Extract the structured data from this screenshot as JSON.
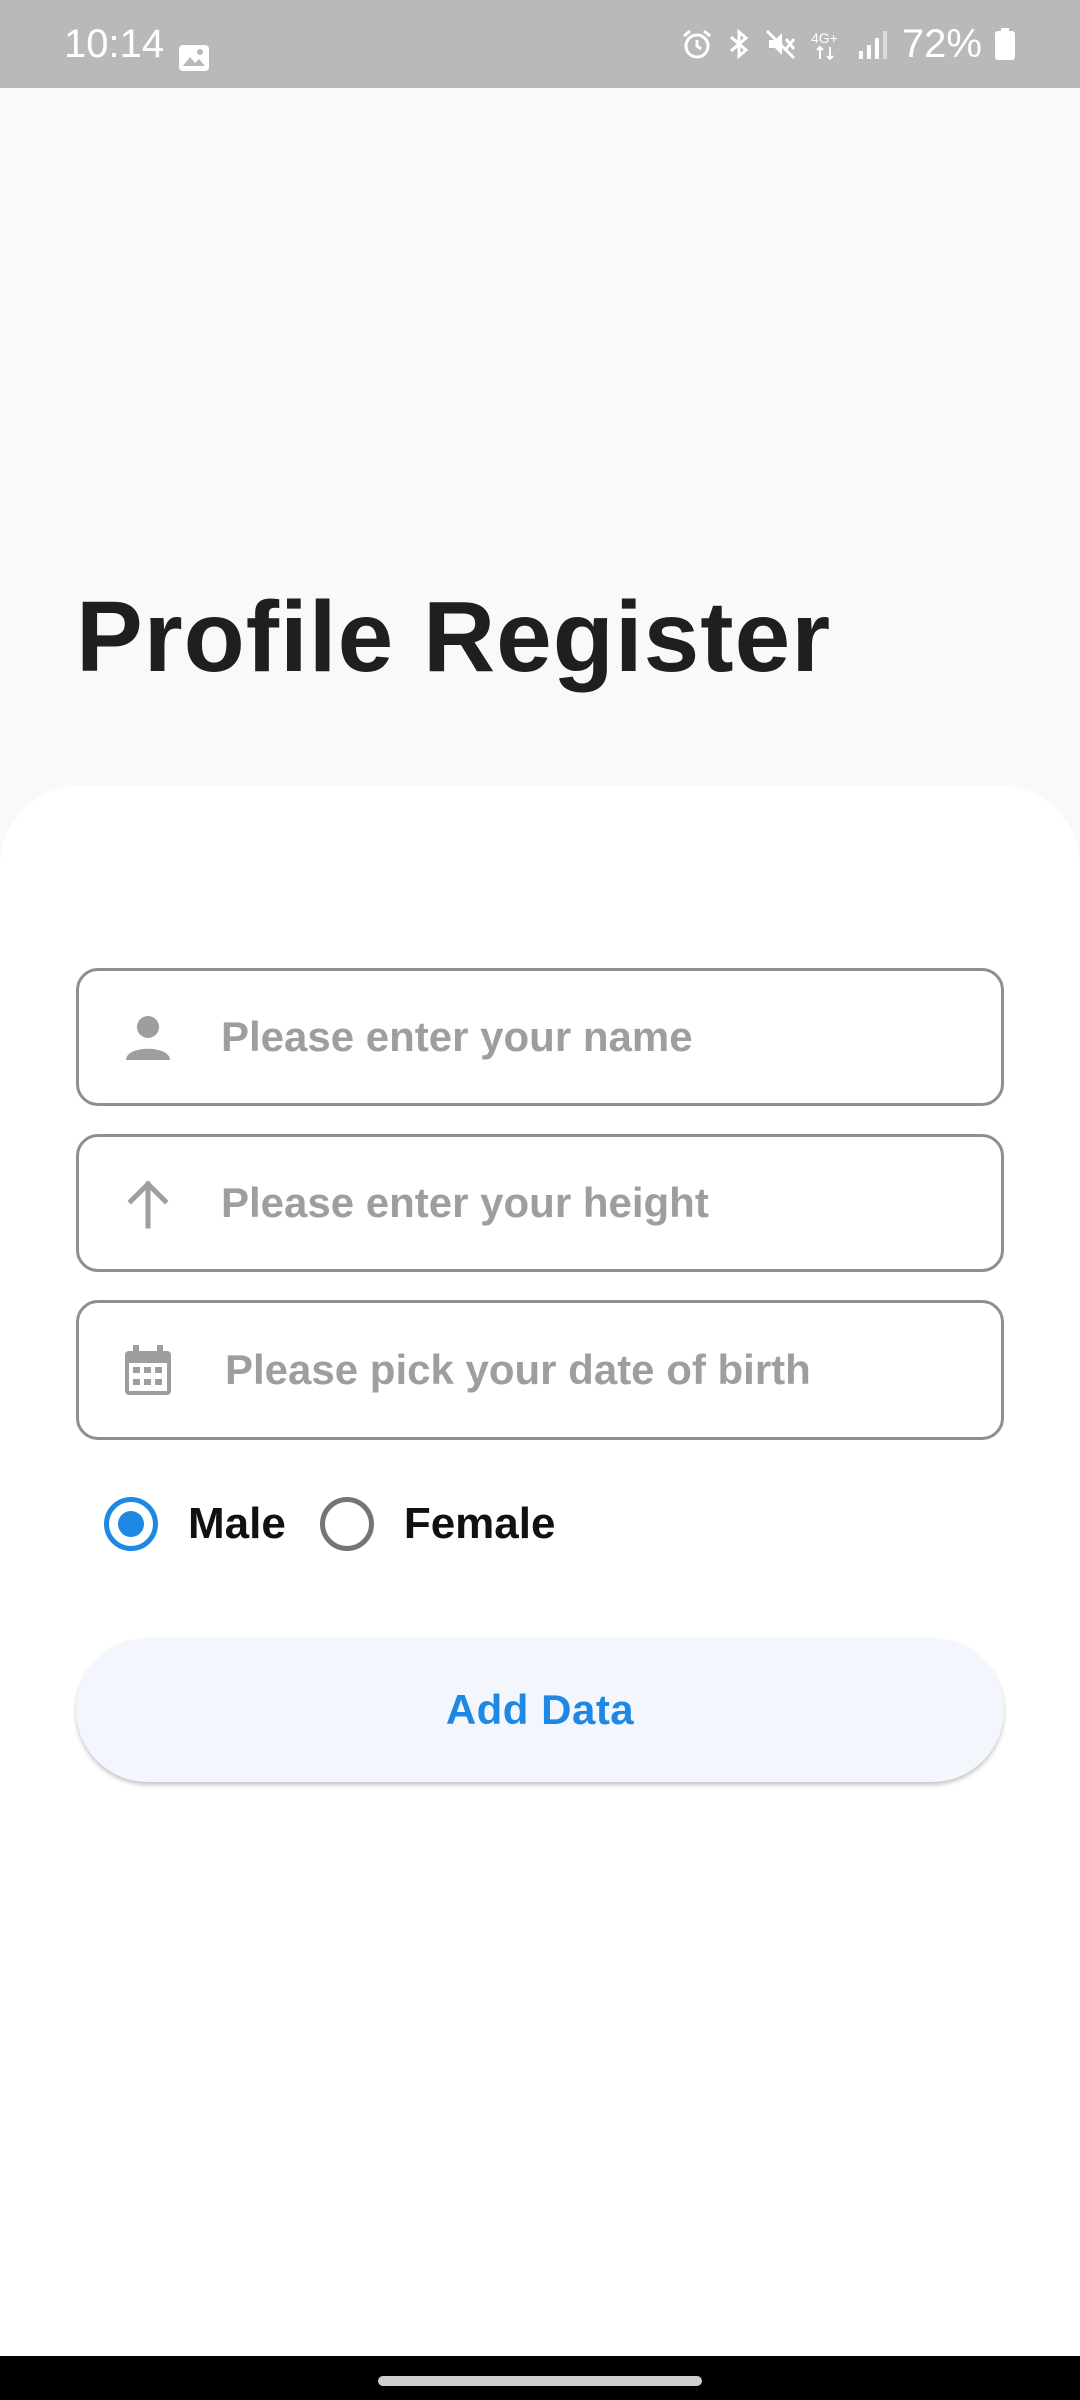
{
  "status_bar": {
    "time": "10:14",
    "battery": "72%",
    "icons": [
      "gallery-icon",
      "alarm-icon",
      "bluetooth-icon",
      "mute-icon",
      "4g-icon",
      "signal-icon",
      "battery-icon"
    ]
  },
  "page": {
    "title": "Profile Register"
  },
  "form": {
    "name_placeholder": "Please enter your name",
    "height_placeholder": "Please enter your height",
    "dob_placeholder": "Please pick your date of birth",
    "gender": {
      "options": [
        "Male",
        "Female"
      ],
      "selected": "Male"
    },
    "submit_label": "Add Data"
  },
  "colors": {
    "accent": "#1e88e5",
    "title": "#1f1f1f",
    "icon": "#9e9e9e",
    "border": "#8f8f8f",
    "status_bar_bg": "#b9b9b9"
  }
}
